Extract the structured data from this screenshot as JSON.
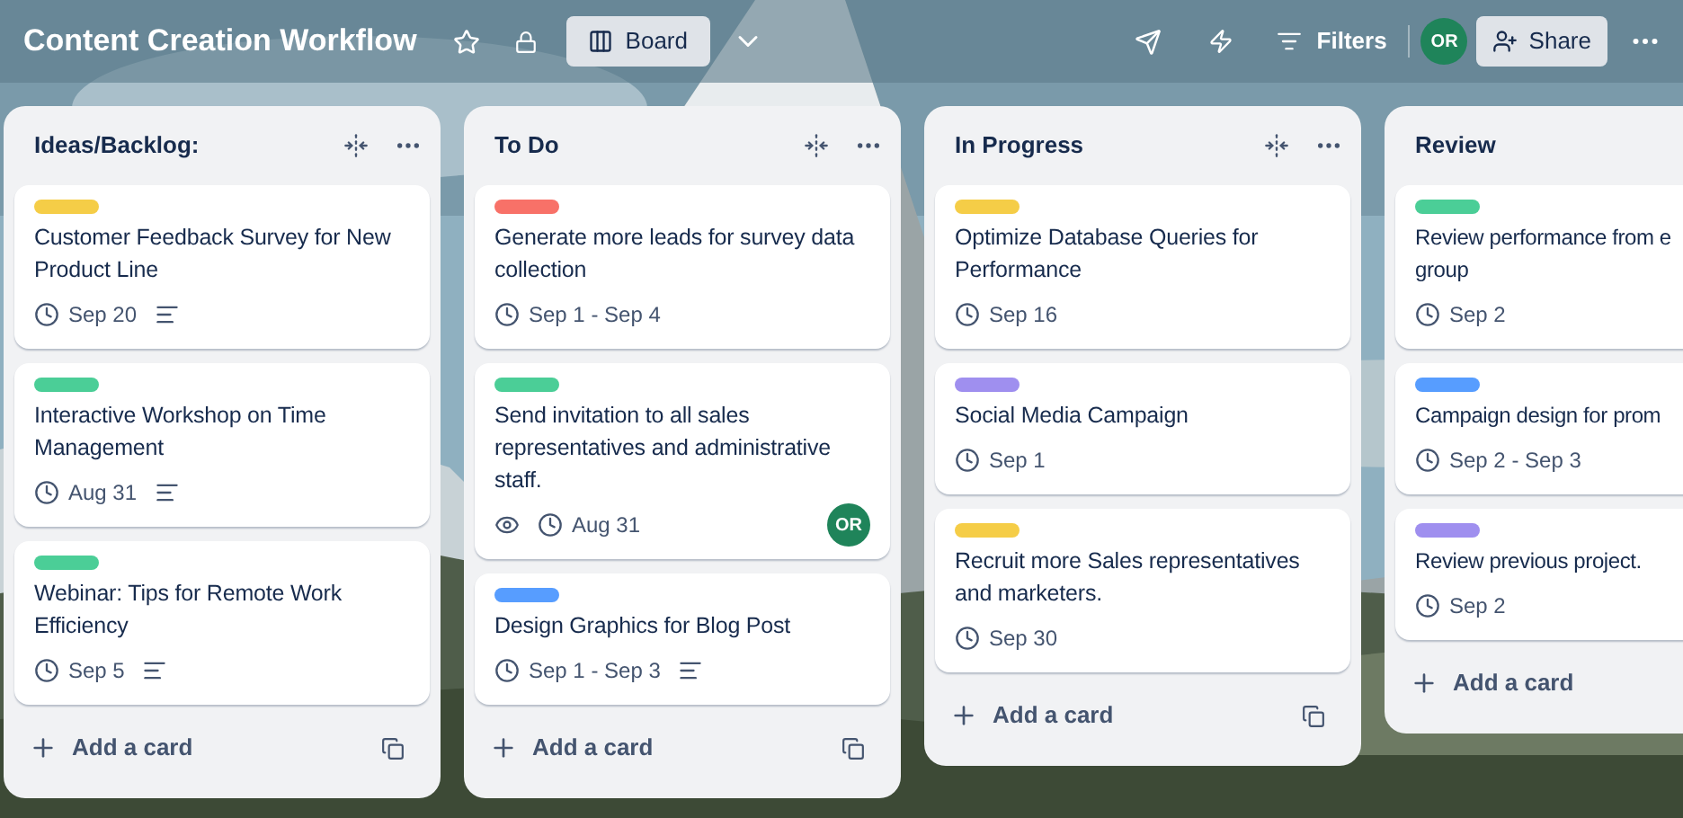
{
  "board": {
    "title": "Content Creation Workflow",
    "starred": false,
    "view_button": "Board"
  },
  "header_actions": {
    "filters": "Filters",
    "member": "OR",
    "share": "Share"
  },
  "lists": [
    {
      "title": "Ideas/Backlog:",
      "clipped": false,
      "add_card": "Add a card",
      "cards": [
        {
          "color": "#f5cd47",
          "title": "Customer Feedback Survey for New Product Line",
          "date": "Sep 20",
          "description": true,
          "watching": false
        },
        {
          "color": "#4bce97",
          "title": "Interactive Workshop on Time Management",
          "date": "Aug 31",
          "description": true,
          "watching": false
        },
        {
          "color": "#4bce97",
          "title": "Webinar: Tips for Remote Work Efficiency",
          "date": "Sep 5",
          "description": true,
          "watching": false
        }
      ]
    },
    {
      "title": "To Do",
      "clipped": false,
      "add_card": "Add a card",
      "cards": [
        {
          "color": "#f87168",
          "title": "Generate more leads for survey data collection",
          "date": "Sep 1 - Sep 4",
          "description": false,
          "watching": false
        },
        {
          "color": "#4bce97",
          "title": "Send invitation to all sales representatives and administrative staff.",
          "date": "Aug 31",
          "description": false,
          "watching": true,
          "member": "OR"
        },
        {
          "color": "#579dff",
          "title": "Design Graphics for Blog Post",
          "date": "Sep 1 - Sep 3",
          "description": true,
          "watching": false
        }
      ]
    },
    {
      "title": "In Progress",
      "clipped": false,
      "add_card": "Add a card",
      "cards": [
        {
          "color": "#f5cd47",
          "title": "Optimize Database Queries for Performance",
          "date": "Sep 16",
          "description": false,
          "watching": false
        },
        {
          "color": "#9f8fef",
          "title": "Social Media Campaign",
          "date": "Sep 1",
          "description": false,
          "watching": false
        },
        {
          "color": "#f5cd47",
          "title": "Recruit more Sales representatives and marketers.",
          "date": "Sep 30",
          "description": false,
          "watching": false
        }
      ]
    },
    {
      "title": "Review",
      "clipped": true,
      "add_card": "Add a card",
      "cards": [
        {
          "color": "#4bce97",
          "title": "Review performance from e\ngroup",
          "date": "Sep 2",
          "description": false,
          "watching": false
        },
        {
          "color": "#579dff",
          "title": "Campaign design for prom",
          "date": "Sep 2 - Sep 3",
          "description": false,
          "watching": false
        },
        {
          "color": "#9f8fef",
          "title": "Review previous project.",
          "date": "Sep 2",
          "description": false,
          "watching": false
        }
      ]
    }
  ]
}
